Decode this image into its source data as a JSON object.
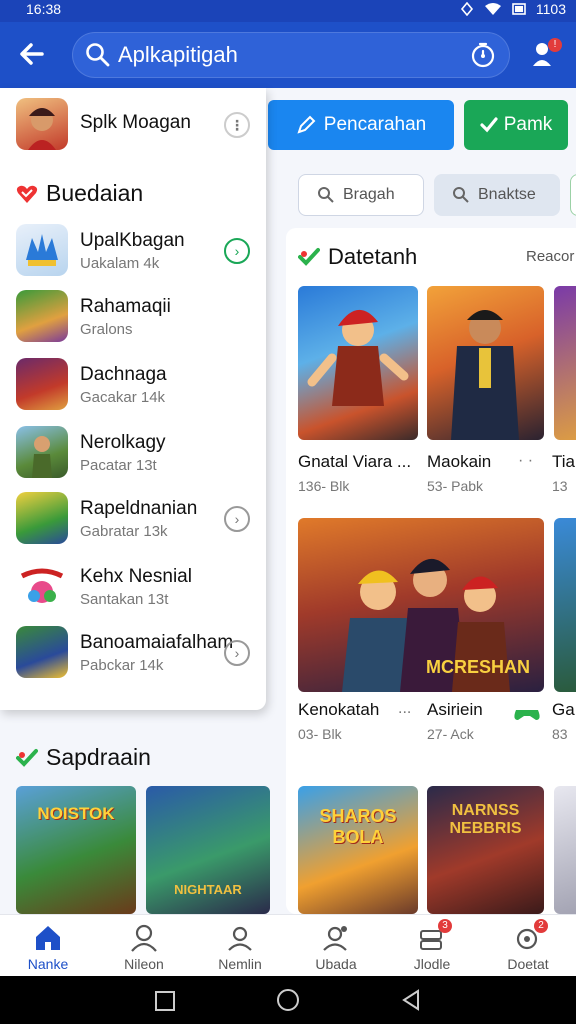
{
  "status_bar": {
    "time": "16:38",
    "battery": "1103"
  },
  "app_bar": {
    "search_text": "Aplkapitigah"
  },
  "main": {
    "buttons": {
      "primary": "Pencarahan",
      "secondary": "Pamk"
    },
    "filters": [
      "Bragah",
      "Bnaktse"
    ],
    "section": {
      "title": "Datetanh",
      "more": "Reacor"
    },
    "row1": [
      {
        "name": "Gnatal Viara ...",
        "sub": "136- Blk"
      },
      {
        "name": "Maokain",
        "sub": "53- Pabk"
      },
      {
        "name": "Tia",
        "sub": "13"
      }
    ],
    "banner_text": "MCRESHAN",
    "row2": [
      {
        "name": "Kenokatah",
        "sub": "03- Blk"
      },
      {
        "name": "Asiriein",
        "sub": "27- Ack"
      },
      {
        "name": "Ga",
        "sub": "83"
      }
    ],
    "row3_texts": [
      "SHAROS BOLA",
      "NARNSS NEBBRIS"
    ]
  },
  "drawer": {
    "top_item": {
      "name": "Splk Moagan"
    },
    "heading": "Buedaian",
    "items": [
      {
        "name": "UpalKbagan",
        "sub": "Uakalam 4k"
      },
      {
        "name": "Rahamaqii",
        "sub": "Gralons"
      },
      {
        "name": "Dachnaga",
        "sub": "Gacakar 14k"
      },
      {
        "name": "Nerolkagy",
        "sub": "Pacatar 13t"
      },
      {
        "name": "Rapeldnanian",
        "sub": "Gabratar 13k"
      },
      {
        "name": "Kehx Nesnial",
        "sub": "Santakan 13t"
      },
      {
        "name": "Banoamaiafalham",
        "sub": "Pabckar 14k"
      }
    ]
  },
  "lower": {
    "title": "Sapdraain",
    "tile_texts": [
      "NOISTOK",
      "NIGHTAAR"
    ]
  },
  "bottom_nav": [
    {
      "label": "Nanke"
    },
    {
      "label": "Nileon"
    },
    {
      "label": "Nemlin"
    },
    {
      "label": "Ubada"
    },
    {
      "label": "Jlodle"
    },
    {
      "label": "Doetat"
    }
  ],
  "colors": {
    "brand": "#1e50c8",
    "accent_blue": "#1a86f0",
    "accent_green": "#1aa757"
  }
}
